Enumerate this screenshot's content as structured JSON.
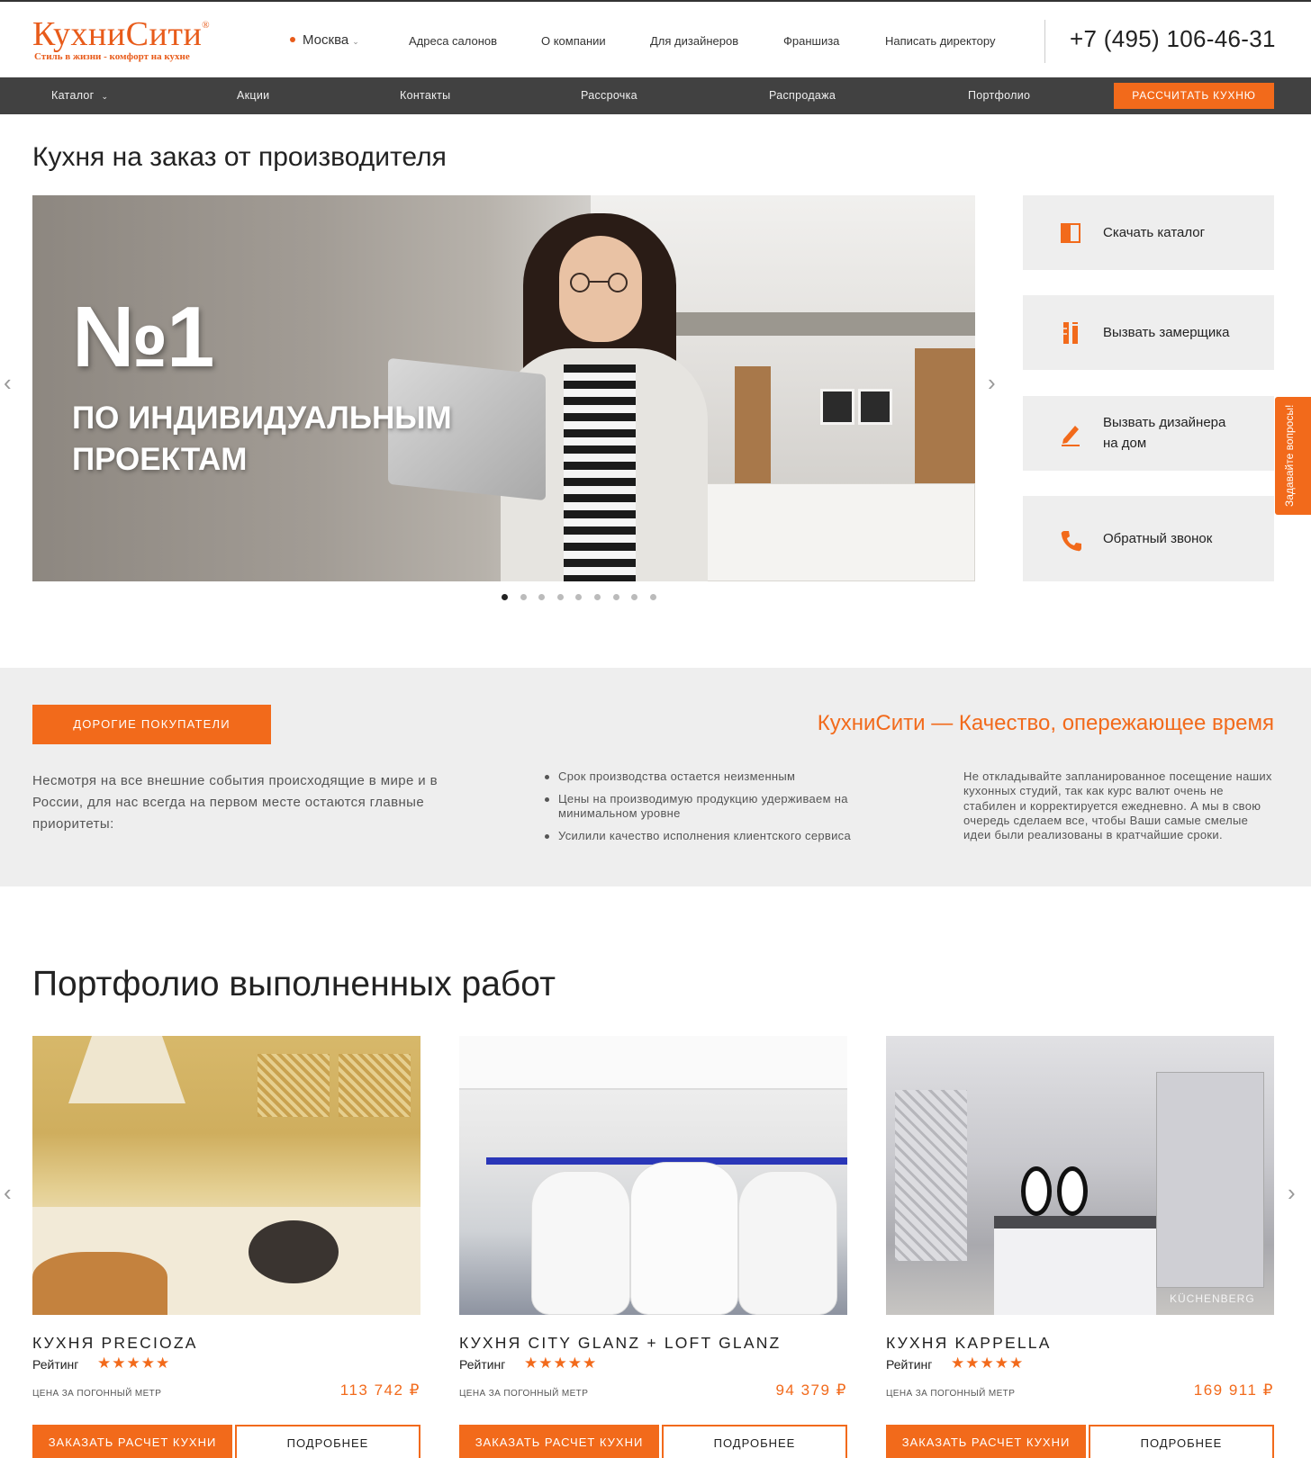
{
  "header": {
    "logo_title": "КухниСити",
    "logo_reg": "®",
    "logo_tagline": "Стиль в жизни - комфорт на кухне",
    "city": "Москва",
    "nav": [
      "Адреса салонов",
      "О компании",
      "Для дизайнеров",
      "Франшиза",
      "Написать директору"
    ],
    "phone": "+7 (495) 106-46-31"
  },
  "main_nav": {
    "items": [
      "Каталог",
      "Акции",
      "Контакты",
      "Рассрочка",
      "Распродажа",
      "Портфолио"
    ],
    "cta": "РАССЧИТАТЬ КУХНЮ"
  },
  "page_title": "Кухня на заказ от производителя",
  "hero": {
    "headline": "№1",
    "subline_1": "ПО ИНДИВИДУАЛЬНЫМ",
    "subline_2": "ПРОЕКТАМ",
    "slides_count": 9,
    "active_slide": 1
  },
  "actions": [
    {
      "label": "Скачать каталог",
      "icon": "book-icon"
    },
    {
      "label": "Вызвать замерщика",
      "icon": "ruler-icon"
    },
    {
      "label_1": "Вызвать дизайнера",
      "label_2": "на дом",
      "icon": "pencil-icon"
    },
    {
      "label": "Обратный звонок",
      "icon": "phone-icon"
    }
  ],
  "side_tab": "Задавайте вопросы!",
  "info_band": {
    "button": "ДОРОГИЕ ПОКУПАТЕЛИ",
    "slogan": "КухниСити — Качество, опережающее время",
    "intro": "Несмотря на все внешние события происходящие в мире и в России, для нас всегда на первом месте остаются главные приоритеты:",
    "bullets": [
      "Срок производства остается неизменным",
      "Цены на производимую продукцию удерживаем на минимальном уровне",
      "Усилили качество исполнения клиентского сервиса"
    ],
    "note": "Не откладывайте запланированное посещение наших кухонных студий, так как курс валют очень не стабилен и корректируется ежедневно. А мы в свою очередь сделаем все, чтобы Ваши самые смелые идеи были реализованы в кратчайшие сроки."
  },
  "portfolio": {
    "title": "Портфолио выполненных работ",
    "items": [
      {
        "name": "КУХНЯ PRECIOZA",
        "rating_label": "Рейтинг",
        "stars": "★★★★★",
        "price_label": "ЦЕНА ЗА ПОГОННЫЙ МЕТР",
        "price": "113 742 ₽",
        "order": "ЗАКАЗАТЬ РАСЧЕТ КУХНИ",
        "more": "ПОДРОБНЕЕ"
      },
      {
        "name": "КУХНЯ CITY GLANZ + LOFT GLANZ",
        "rating_label": "Рейтинг",
        "stars": "★★★★★",
        "price_label": "ЦЕНА ЗА ПОГОННЫЙ МЕТР",
        "price": "94 379 ₽",
        "order": "ЗАКАЗАТЬ РАСЧЕТ КУХНИ",
        "more": "ПОДРОБНЕЕ"
      },
      {
        "name": "КУХНЯ KAPPELLA",
        "rating_label": "Рейтинг",
        "stars": "★★★★★",
        "price_label": "ЦЕНА ЗА ПОГОННЫЙ МЕТР",
        "price": "169 911 ₽",
        "order": "ЗАКАЗАТЬ РАСЧЕТ КУХНИ",
        "more": "ПОДРОБНЕЕ",
        "watermark": "KÜCHENBERG"
      }
    ]
  },
  "colors": {
    "accent": "#f26a1b",
    "dark_nav": "#414141",
    "band": "#eeeeee"
  }
}
